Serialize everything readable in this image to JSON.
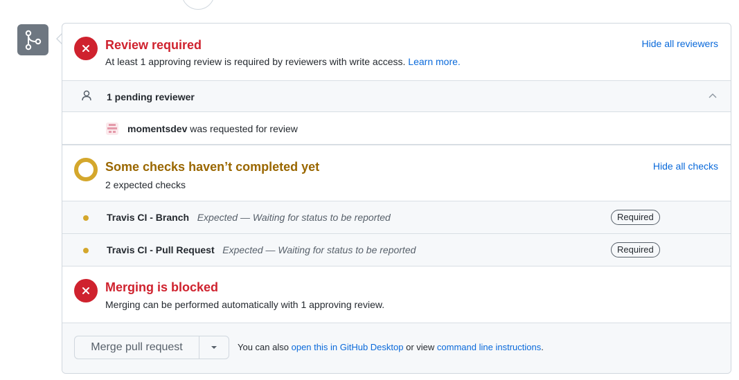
{
  "review": {
    "title": "Review required",
    "subtitle_prefix": "At least 1 approving review is required by reviewers with write access.",
    "learn_more": "Learn more.",
    "hide_link": "Hide all reviewers",
    "pending_label": "1 pending reviewer",
    "reviewer_name": "momentsdev",
    "reviewer_suffix": "was requested for review"
  },
  "checks": {
    "title": "Some checks haven’t completed yet",
    "subtitle": "2 expected checks",
    "hide_link": "Hide all checks",
    "items": [
      {
        "name": "Travis CI - Branch",
        "status": "Expected — Waiting for status to be reported",
        "badge": "Required"
      },
      {
        "name": "Travis CI - Pull Request",
        "status": "Expected — Waiting for status to be reported",
        "badge": "Required"
      }
    ]
  },
  "merge": {
    "title": "Merging is blocked",
    "subtitle": "Merging can be performed automatically with 1 approving review.",
    "button_label": "Merge pull request",
    "note_prefix": "You can also",
    "note_link1": "open this in GitHub Desktop",
    "note_middle": "or view",
    "note_link2": "command line instructions",
    "note_suffix": "."
  },
  "colors": {
    "danger": "#cf222e",
    "pending": "#d4a72c",
    "link": "#0969da"
  },
  "icons": [
    "git-merge-icon",
    "x-icon",
    "person-icon",
    "chevron-up-icon",
    "avatar",
    "pending-ring-icon",
    "dot-icon",
    "caret-down-icon"
  ]
}
